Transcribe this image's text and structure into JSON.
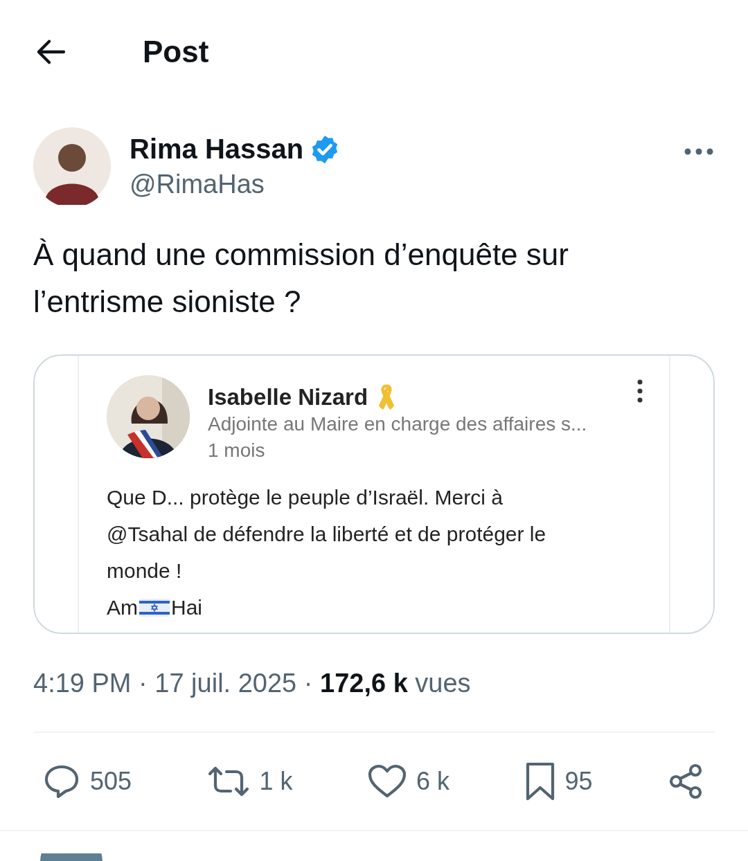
{
  "header": {
    "title": "Post"
  },
  "author": {
    "name": "Rima Hassan",
    "handle": "@RimaHas",
    "verified": true
  },
  "text": "À quand une commission d’enquête sur l’entrisme sioniste ?",
  "quote": {
    "name": "Isabelle Nizard",
    "subtitle": "Adjointe au Maire en charge des affaires s...",
    "time": "1 mois",
    "body": [
      "Que D... protège le peuple d’Israël. Merci à",
      "@Tsahal de défendre la liberté et de protéger le",
      "monde !"
    ],
    "last_line": {
      "before": "Am",
      "after": "Hai"
    }
  },
  "meta": "4:19 PM · 17 juil. 2025 · **172,6 k** vues",
  "actions": [
    {
      "kind": "reply",
      "count": "505"
    },
    {
      "kind": "repost",
      "count": "1 k"
    },
    {
      "kind": "like",
      "count": "6 k"
    },
    {
      "kind": "bookmark",
      "count": "95"
    },
    {
      "kind": "share"
    }
  ]
}
